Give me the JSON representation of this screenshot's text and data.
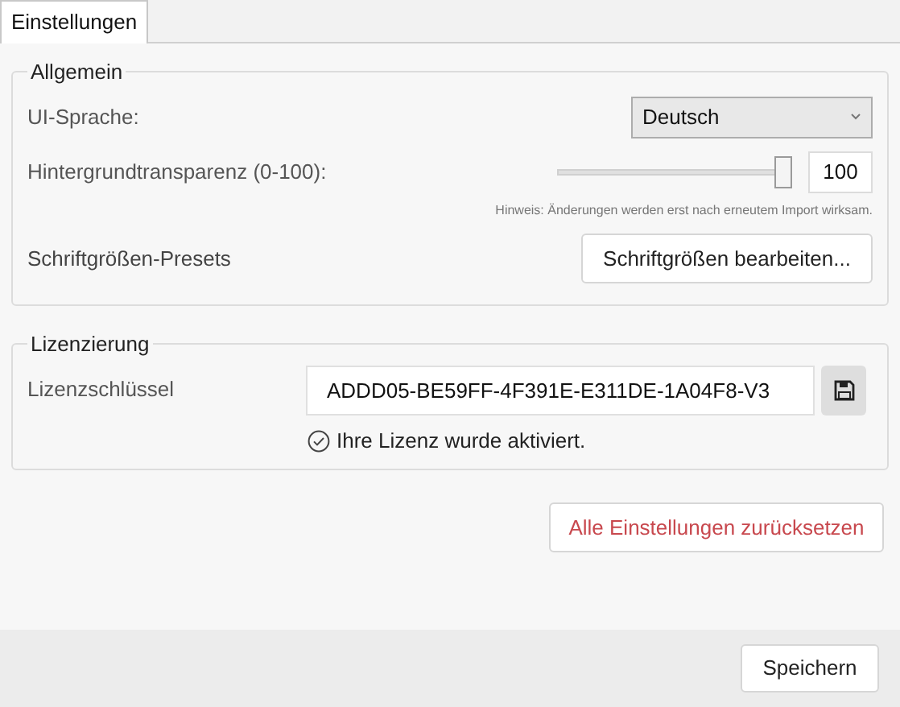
{
  "tabs": [
    {
      "label": "Einstellungen",
      "selected": true
    }
  ],
  "general": {
    "title": "Allgemein",
    "language": {
      "label": "UI-Sprache:",
      "value": "Deutsch"
    },
    "transparency": {
      "label": "Hintergrundtransparenz (0-100):",
      "level": 1,
      "value": "100"
    },
    "hint": "Hinweis: Änderungen werden erst nach erneutem Import wirksam.",
    "font_presets": {
      "label": "Schriftgrößen-Presets",
      "button": "Schriftgrößen bearbeiten..."
    }
  },
  "licensing": {
    "title": "Lizenzierung",
    "key_label": "Lizenzschlüssel",
    "key_value": "ADDD05-BE59FF-4F391E-E311DE-1A04F8-V3",
    "activated": true,
    "status": "Ihre Lizenz wurde aktiviert."
  },
  "reset_button": "Alle Einstellungen zurücksetzen",
  "save_button": "Speichern"
}
